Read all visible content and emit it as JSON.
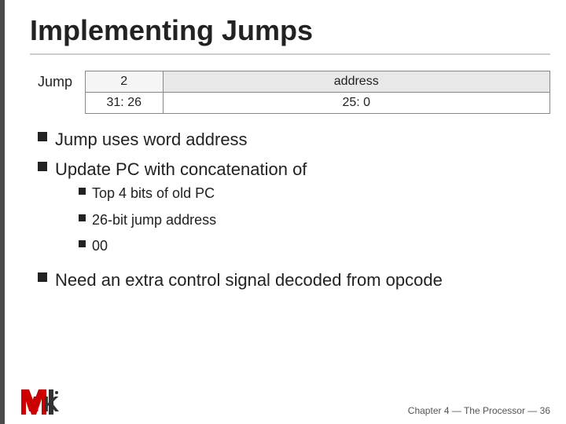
{
  "title": "Implementing Jumps",
  "diagram": {
    "jump_label": "Jump",
    "col1_value": "2",
    "col2_value": "address",
    "col1_bits": "31: 26",
    "col2_bits": "25: 0"
  },
  "bullets": [
    {
      "text": "Jump uses word address"
    },
    {
      "text": "Update PC with concatenation of",
      "sub_bullets": [
        {
          "text": "Top 4 bits of old PC"
        },
        {
          "text": "26-bit jump address"
        },
        {
          "text": "00"
        }
      ]
    },
    {
      "text": "Need an extra control signal decoded from opcode"
    }
  ],
  "footer": "Chapter 4 — The Processor — 36"
}
